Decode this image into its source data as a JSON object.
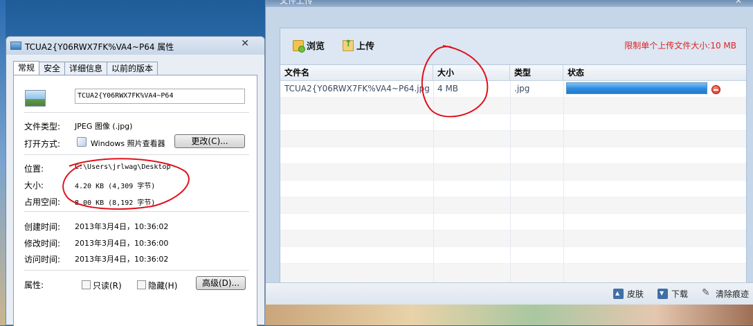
{
  "upload": {
    "title": "文件上传",
    "toolbar": {
      "browse_label": "浏览",
      "upload_label": "上传",
      "limit_text": "限制单个上传文件大小:10 MB"
    },
    "columns": [
      "文件名",
      "大小",
      "类型",
      "状态"
    ],
    "rows": [
      {
        "name": "TCUA2{Y06RWX7FK%VA4~P64.jpg",
        "size": "4 MB",
        "type": ".jpg",
        "progress": 100
      }
    ],
    "statusbar": {
      "skin_label": "皮肤",
      "download_label": "下载",
      "clear_label": "清除痕迹"
    }
  },
  "properties": {
    "title": "TCUA2{Y06RWX7FK%VA4~P64 属性",
    "tabs": [
      "常规",
      "安全",
      "详细信息",
      "以前的版本"
    ],
    "active_tab": "常规",
    "file_name": "TCUA2{Y06RWX7FK%VA4~P64",
    "file_type_label": "文件类型:",
    "file_type_value": "JPEG 图像 (.jpg)",
    "open_with_label": "打开方式:",
    "open_with_value": "Windows 照片查看器",
    "change_button": "更改(C)...",
    "location_label": "位置:",
    "location_value": "C:\\Users\\jrlwag\\Desktop",
    "size_label": "大小:",
    "size_value": "4.20 KB (4,309 字节)",
    "size_on_disk_label": "占用空间:",
    "size_on_disk_value": "8.00 KB (8,192 字节)",
    "created_label": "创建时间:",
    "created_value": "2013年3月4日，10:36:02",
    "modified_label": "修改时间:",
    "modified_value": "2013年3月4日，10:36:00",
    "accessed_label": "访问时间:",
    "accessed_value": "2013年3月4日，10:36:02",
    "attributes_label": "属性:",
    "readonly_label": "只读(R)",
    "hidden_label": "隐藏(H)",
    "advanced_button": "高级(D)..."
  },
  "colors": {
    "limit_text": "#e12020",
    "progress": "#2b8bdf",
    "annotation": "#e0101a"
  }
}
